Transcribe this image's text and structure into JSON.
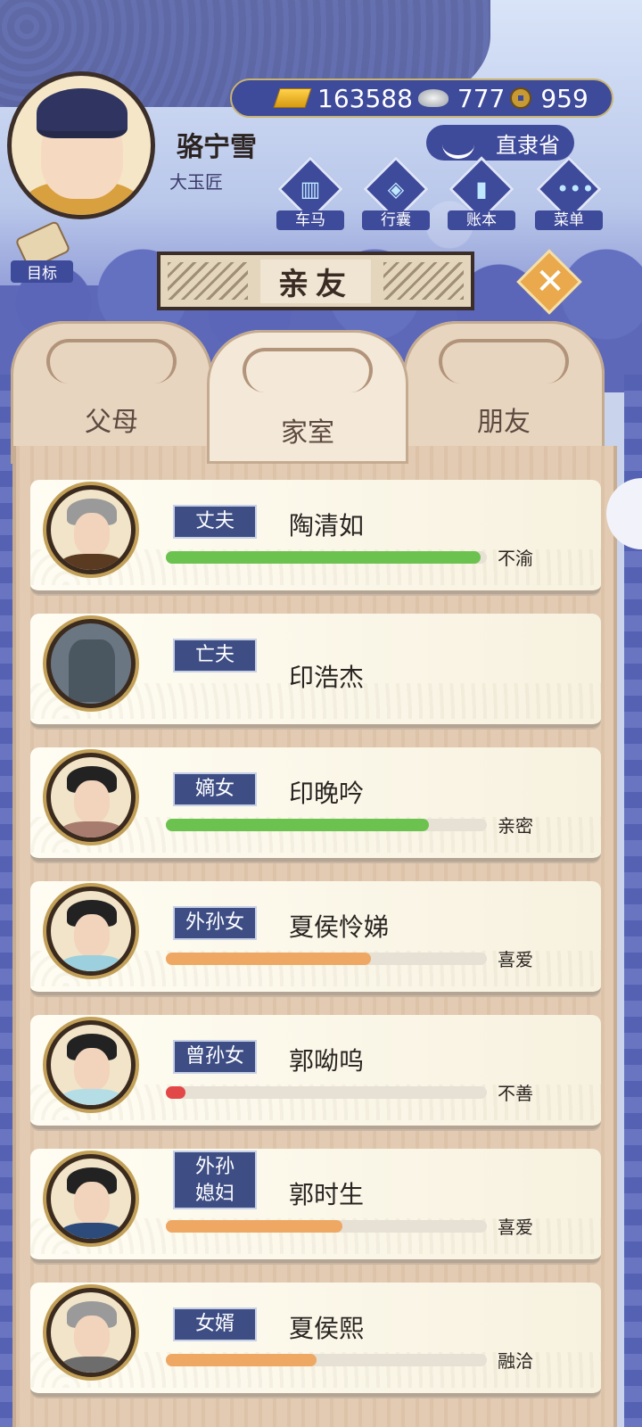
{
  "player": {
    "name": "骆宁雪",
    "title": "大玉匠"
  },
  "currency": {
    "gold": "163588",
    "silver": "777",
    "coins": "959"
  },
  "location": "直隶省",
  "menu": [
    {
      "label": "车马",
      "icon": "carriage-icon"
    },
    {
      "label": "行囊",
      "icon": "bag-icon"
    },
    {
      "label": "账本",
      "icon": "ledger-icon"
    },
    {
      "label": "菜单",
      "icon": "more-icon"
    }
  ],
  "goal": {
    "label": "目标",
    "icon": "scroll-icon"
  },
  "page_title": "亲友",
  "tabs": [
    {
      "label": "父母"
    },
    {
      "label": "家室"
    },
    {
      "label": "朋友"
    }
  ],
  "active_tab": "家室",
  "relatives": [
    {
      "role": "丈夫",
      "name": "陶清如",
      "relation": "不渝",
      "affection": 0.98,
      "bar_color": "#6cc24f"
    },
    {
      "role": "亡夫",
      "name": "印浩杰",
      "relation": "",
      "affection": null,
      "bar_color": ""
    },
    {
      "role": "嫡女",
      "name": "印晚吟",
      "relation": "亲密",
      "affection": 0.82,
      "bar_color": "#6cc24f"
    },
    {
      "role": "外孙女",
      "name": "夏侯怜娣",
      "relation": "喜爱",
      "affection": 0.64,
      "bar_color": "#eea863"
    },
    {
      "role": "曾孙女",
      "name": "郭呦呜",
      "relation": "不善",
      "affection": 0.06,
      "bar_color": "#e24848"
    },
    {
      "role": "外孙媳妇",
      "name": "郭时生",
      "relation": "喜爱",
      "affection": 0.55,
      "bar_color": "#eea863"
    },
    {
      "role": "女婿",
      "name": "夏侯熙",
      "relation": "融洽",
      "affection": 0.47,
      "bar_color": "#eea863"
    }
  ]
}
